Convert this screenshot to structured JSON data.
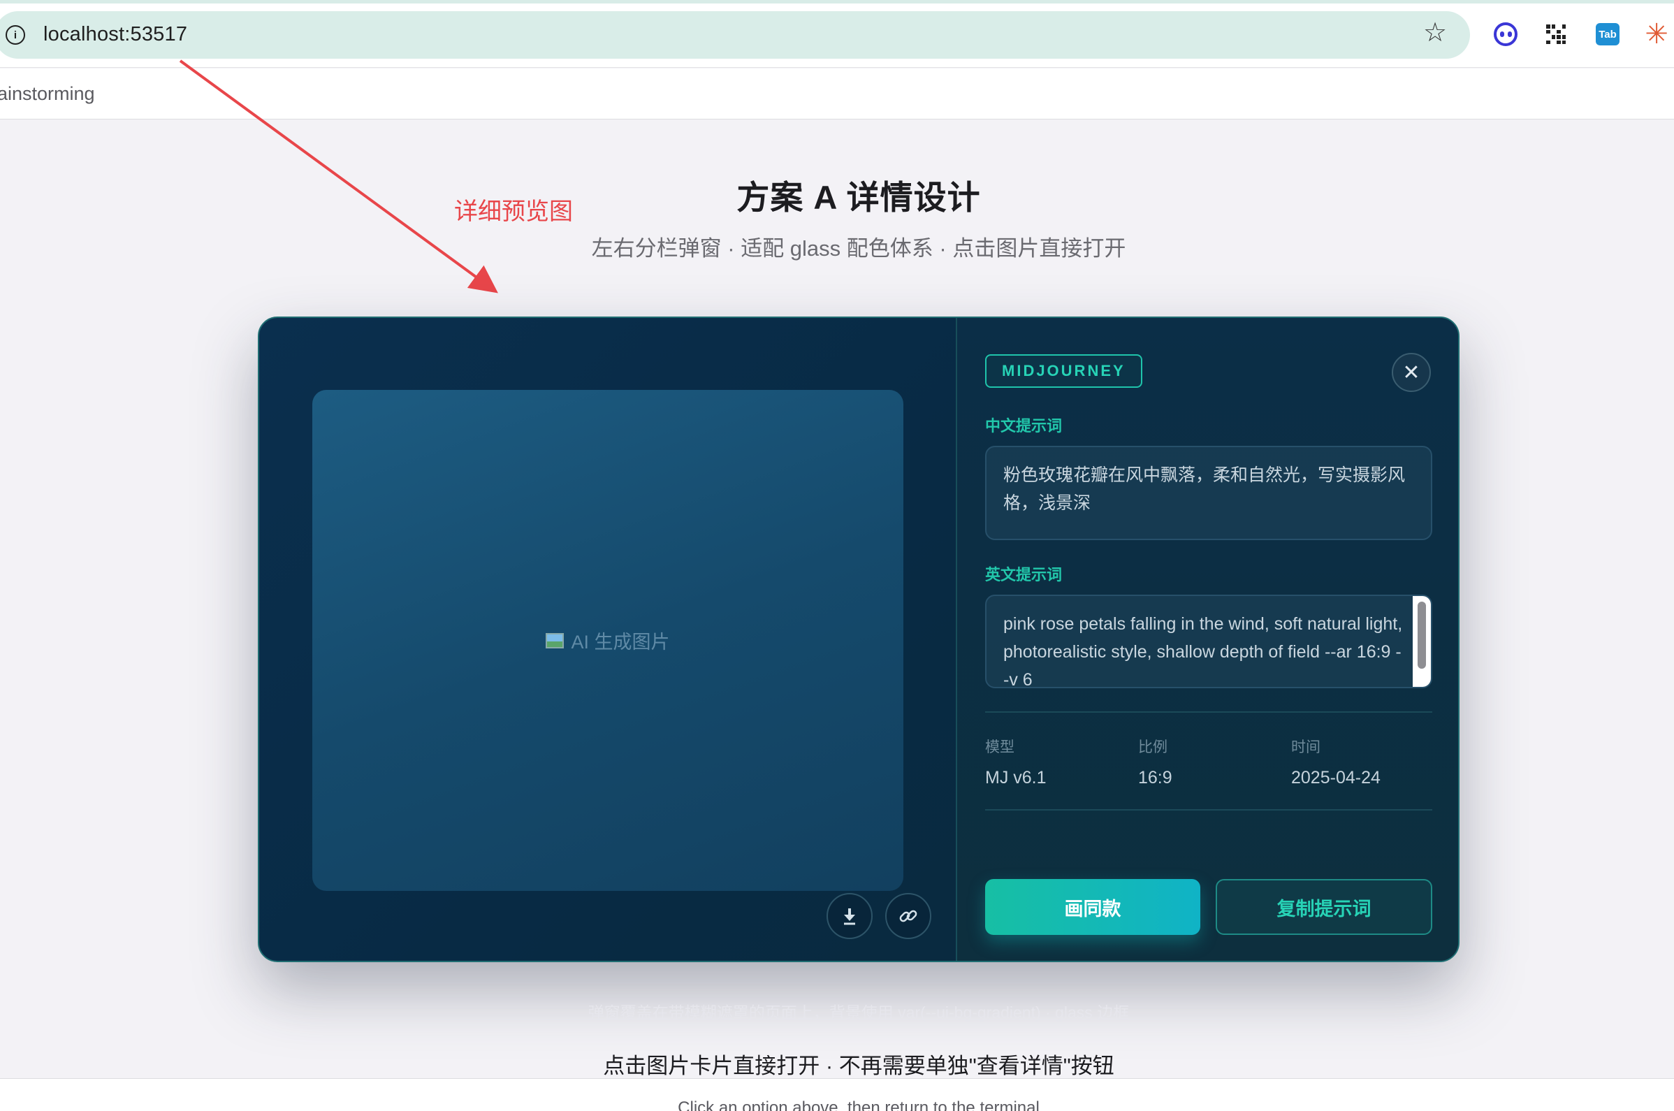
{
  "browser": {
    "url": "localhost:53517",
    "tab_title": "ainstorming",
    "extensions": [
      "face-extension-icon",
      "qr-code-icon",
      "tab-extension-icon",
      "sparkle-extension-icon"
    ],
    "tab_ext_label": "Tab"
  },
  "page": {
    "title": "方案 A 详情设计",
    "subtitle": "左右分栏弹窗 · 适配 glass 配色体系 · 点击图片直接打开",
    "annotation": "详细预览图",
    "caption_faded": "弹窗覆盖在带模糊遮罩的页面上，背景使用 var(--ui-bg-gradient) · glass 边框",
    "caption_main": "点击图片卡片直接打开 · 不再需要单独\"查看详情\"按钮",
    "footer": "Click an option above, then return to the terminal"
  },
  "modal": {
    "preview_label": "AI 生成图片",
    "badge": "MIDJOURNEY",
    "cn_prompt_label": "中文提示词",
    "cn_prompt": "粉色玫瑰花瓣在风中飘落，柔和自然光，写实摄影风格，浅景深",
    "en_prompt_label": "英文提示词",
    "en_prompt": "pink rose petals falling in the wind, soft natural light, photorealistic style, shallow depth of field --ar 16:9 --v 6",
    "meta": [
      {
        "key": "模型",
        "value": "MJ v6.1"
      },
      {
        "key": "比例",
        "value": "16:9"
      },
      {
        "key": "时间",
        "value": "2025-04-24"
      }
    ],
    "primary_button": "画同款",
    "secondary_button": "复制提示词"
  },
  "colors": {
    "accent": "#22c7ab",
    "annotation": "#e8464a",
    "modal_bg": "#0a2f4e"
  }
}
